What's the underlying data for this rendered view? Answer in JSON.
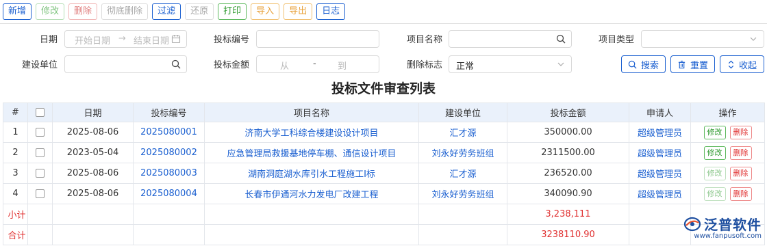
{
  "toolbar": {
    "buttons": [
      "新增",
      "修改",
      "删除",
      "彻底删除",
      "过滤",
      "还原",
      "打印",
      "导入",
      "导出",
      "日志"
    ]
  },
  "filters": {
    "date_label": "日期",
    "date_start_placeholder": "开始日期",
    "date_arrow": "→",
    "date_end_placeholder": "结束日期",
    "bid_no_label": "投标编号",
    "project_name_label": "项目名称",
    "project_type_label": "项目类型",
    "unit_label": "建设单位",
    "amount_label": "投标金额",
    "amount_from_placeholder": "从",
    "amount_dash": "-",
    "amount_to_placeholder": "到",
    "delete_flag_label": "删除标志",
    "delete_flag_value": "正常"
  },
  "actions": {
    "search": "搜索",
    "reset": "重置",
    "collapse": "收起"
  },
  "page_title": "投标文件审查列表",
  "table": {
    "headers": [
      "#",
      "",
      "日期",
      "投标编号",
      "项目名称",
      "建设单位",
      "投标金额",
      "申请人",
      "操作"
    ],
    "rows": [
      {
        "idx": "1",
        "date": "2025-08-06",
        "no": "2025080001",
        "name": "济南大学工科综合楼建设设计项目",
        "unit": "汇才源",
        "amount": "350000.00",
        "applicant": "超级管理员"
      },
      {
        "idx": "2",
        "date": "2023-05-04",
        "no": "2025080002",
        "name": "应急管理局救援基地停车棚、通信设计项目",
        "unit": "刘永好劳务班组",
        "amount": "2311500.00",
        "applicant": "超级管理员"
      },
      {
        "idx": "3",
        "date": "2025-08-06",
        "no": "2025080003",
        "name": "湖南洞庭湖水库引水工程施工I标",
        "unit": "汇才源",
        "amount": "236520.00",
        "applicant": "超级管理员"
      },
      {
        "idx": "4",
        "date": "2025-08-06",
        "no": "2025080004",
        "name": "长春市伊通河水力发电厂改建工程",
        "unit": "刘永好劳务班组",
        "amount": "340090.90",
        "applicant": "超级管理员"
      }
    ],
    "edit_label": "修改",
    "delete_label": "删除",
    "subtotal_label": "小计",
    "subtotal_value": "3,238,111",
    "total_label": "合计",
    "total_value": "3238110.90"
  },
  "logo": {
    "text": "泛普软件",
    "url": "www.fanpusoft.com"
  },
  "colors": {
    "primary": "#1a5fd0",
    "header_bg": "#eaf1fb",
    "red": "#e03030",
    "green": "#2f9a2f"
  }
}
